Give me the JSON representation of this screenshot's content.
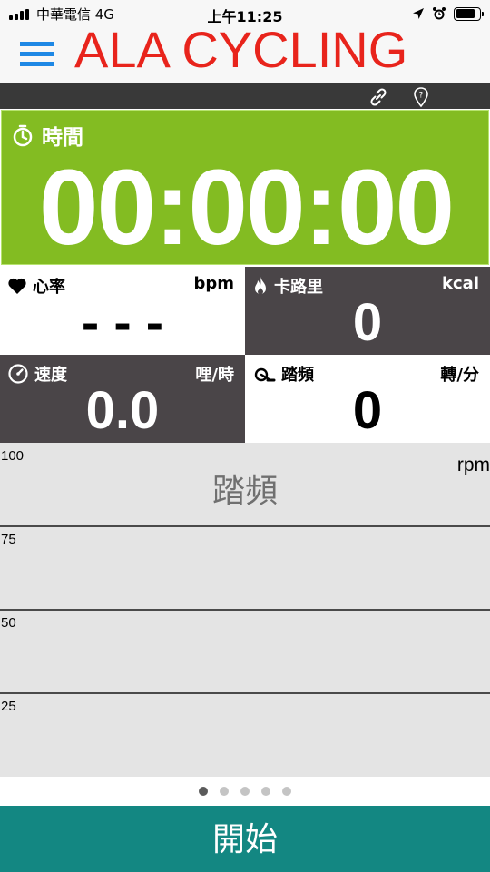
{
  "status_bar": {
    "carrier": "中華電信  4G",
    "time": "上午11:25",
    "icons": [
      "signal-icon",
      "location-arrow-icon",
      "alarm-icon",
      "battery-icon"
    ],
    "battery_level": 0.8
  },
  "header": {
    "title": "ALA CYCLING",
    "title_color": "#e8241c",
    "menu_icon": "hamburger-menu-icon",
    "accent": "#1e88e5"
  },
  "toolbar": {
    "icons": [
      "link-icon",
      "location-pin-icon"
    ]
  },
  "timer": {
    "label": "時間",
    "value": "00:00:00",
    "icon": "stopwatch-icon",
    "color": "#83bc22"
  },
  "metrics": {
    "heart_rate": {
      "label": "心率",
      "unit": "bpm",
      "value": "- - -",
      "icon": "heart-icon"
    },
    "calories": {
      "label": "卡路里",
      "unit": "kcal",
      "value": "0",
      "icon": "flame-icon"
    },
    "speed": {
      "label": "速度",
      "unit": "哩/時",
      "value": "0.0",
      "icon": "speedometer-icon"
    },
    "cadence": {
      "label": "踏頻",
      "unit": "轉/分",
      "value": "0",
      "icon": "pedal-icon"
    }
  },
  "chart": {
    "title": "踏頻",
    "unit": "rpm",
    "ticks": [
      "100",
      "75",
      "50",
      "25"
    ]
  },
  "pager": {
    "count": 5,
    "active_index": 0
  },
  "start_button": {
    "label": "開始",
    "color": "#138782"
  }
}
